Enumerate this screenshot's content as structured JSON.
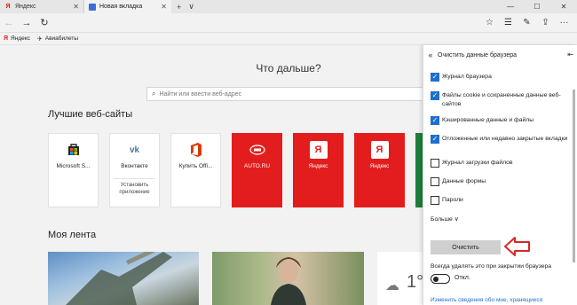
{
  "tabs": [
    {
      "title": "Яндекс",
      "active": false,
      "icon": "yandex-icon"
    },
    {
      "title": "Новая вкладка",
      "active": true,
      "icon": "edge-icon"
    }
  ],
  "tabbar": {
    "new_tab": "+",
    "tabs_menu": "∨",
    "close": "✕"
  },
  "window_controls": {
    "minimize": "—",
    "maximize": "☐",
    "close": "✕"
  },
  "nav": {
    "back": "←",
    "forward": "→",
    "refresh": "↻",
    "hub": "☰",
    "notes": "✎",
    "share": "⇪",
    "more": "···",
    "reading": "☆"
  },
  "favorites": [
    {
      "label": "Яндекс",
      "icon": "yandex-icon"
    },
    {
      "label": "Авиабилеты",
      "icon": "plane-icon"
    }
  ],
  "main": {
    "question": "Что дальше?",
    "search_placeholder": "Найти или ввести веб-адрес",
    "top_sites_title": "Лучшие веб-сайты",
    "feed_title": "Моя лента",
    "weather_temp": "1°C"
  },
  "tiles": [
    {
      "label": "Microsoft S...",
      "icon": "microsoft-store-icon",
      "style": "white"
    },
    {
      "label": "Вконтакте",
      "icon": "vk-icon",
      "style": "white",
      "action": "Установить приложение"
    },
    {
      "label": "Купить Offi...",
      "icon": "office-icon",
      "style": "white"
    },
    {
      "label": "AUTO.RU",
      "icon": "autoru-icon",
      "style": "red"
    },
    {
      "label": "Яндекс",
      "icon": "yandex-icon",
      "style": "red"
    },
    {
      "label": "Яндекс",
      "icon": "yandex-icon",
      "style": "red"
    }
  ],
  "panel": {
    "title": "Очистить данные браузера",
    "options": [
      {
        "label": "Журнал браузера",
        "checked": true
      },
      {
        "label": "Файлы cookie и сохраненные данные веб-сайтов",
        "checked": true
      },
      {
        "label": "Кэшированные данные и файлы",
        "checked": true
      },
      {
        "label": "Отложенные или недавно закрытые вкладки",
        "checked": true
      },
      {
        "label": "Журнал загрузки файлов",
        "checked": false
      },
      {
        "label": "Данные формы",
        "checked": false
      },
      {
        "label": "Пароли",
        "checked": false
      }
    ],
    "more": "Больше ∨",
    "clear_button": "Очистить",
    "always_clear": "Всегда удалять это при закрытии браузера",
    "toggle_label": "Откл.",
    "toggle_on": false,
    "link": "Изменить сведения обо мне, хранящиеся"
  },
  "colors": {
    "accent": "#1f6fcf",
    "yandex_red": "#e31d1d",
    "arrow": "#d62828"
  }
}
